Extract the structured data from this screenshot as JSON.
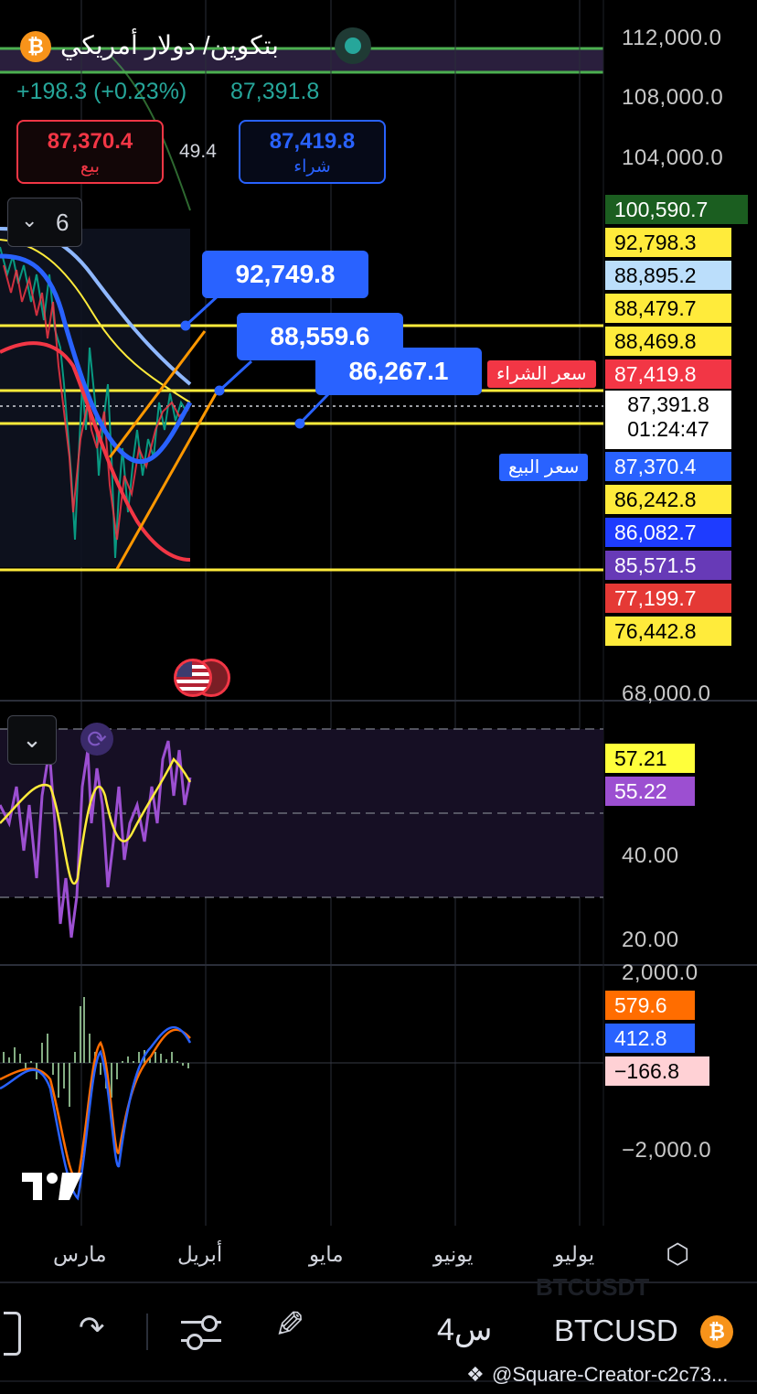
{
  "header": {
    "title": "بتكوين/ دولار أمريكي",
    "change": "+198.3 (+0.23%)",
    "last": "87,391.8"
  },
  "trade": {
    "sell_price": "87,370.4",
    "sell_label": "بيع",
    "spread": "49.4",
    "buy_price": "87,419.8",
    "buy_label": "شراء"
  },
  "indicators": {
    "count": "6"
  },
  "callouts": [
    "92,749.8",
    "88,559.6",
    "86,267.1"
  ],
  "tags": {
    "ask": "سعر الشراء",
    "bid": "سعر البيع"
  },
  "axis": {
    "price": [
      "112,000.0",
      "108,000.0",
      "104,000.0",
      "68,000.0"
    ]
  },
  "price_labels": [
    {
      "text": "100,590.7",
      "color": "#1b5e20"
    },
    {
      "text": "92,798.3",
      "color": "#ffeb3b"
    },
    {
      "text": "88,895.2",
      "color": "#bbdefb"
    },
    {
      "text": "88,479.7",
      "color": "#ffeb3b"
    },
    {
      "text": "88,469.8",
      "color": "#ffeb3b"
    },
    {
      "text": "87,419.8",
      "color": "#f23645"
    },
    {
      "text": "87,370.4",
      "color": "#2962ff"
    },
    {
      "text": "86,242.8",
      "color": "#ffeb3b"
    },
    {
      "text": "86,082.7",
      "color": "#1e3cff"
    },
    {
      "text": "85,571.5",
      "color": "#673ab7"
    },
    {
      "text": "77,199.7",
      "color": "#e53935"
    },
    {
      "text": "76,442.8",
      "color": "#ffeb3b"
    }
  ],
  "current": {
    "price": "87,391.8",
    "countdown": "01:24:47"
  },
  "rsi": {
    "values": [
      "57.21",
      "55.22"
    ],
    "ticks": [
      "40.00",
      "20.00"
    ]
  },
  "macd": {
    "values": [
      "579.6",
      "412.8",
      "−166.8"
    ],
    "ticks": [
      "2,000.0",
      "−2,000.0"
    ]
  },
  "time_axis": [
    "مارس",
    "أبريل",
    "مايو",
    "يونيو",
    "يوليو"
  ],
  "watermark": "BTCUSDT",
  "toolbar": {
    "interval": "4س",
    "symbol": "BTCUSD"
  },
  "credit": "@Square-Creator-c2c73...",
  "colors": {
    "up": "#26a69a",
    "down": "#f23645",
    "accent": "#2962ff",
    "level": "#ffeb3b"
  }
}
